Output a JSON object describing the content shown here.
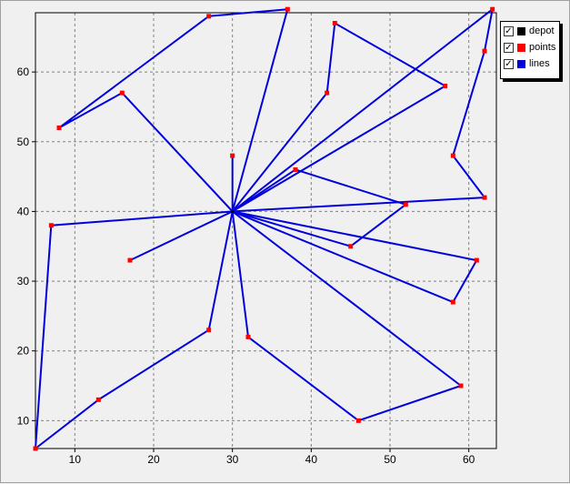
{
  "chart_data": {
    "type": "scatter",
    "xlim": [
      5,
      63.5
    ],
    "ylim": [
      6,
      68.5
    ],
    "x_ticks": [
      10,
      20,
      30,
      40,
      50,
      60
    ],
    "y_ticks": [
      10,
      20,
      30,
      40,
      50,
      60
    ],
    "grid": true,
    "legend_placement": "top-right",
    "depot": {
      "x": 30,
      "y": 40
    },
    "points": [
      {
        "x": 5,
        "y": 6
      },
      {
        "x": 7,
        "y": 38
      },
      {
        "x": 8,
        "y": 52
      },
      {
        "x": 13,
        "y": 13
      },
      {
        "x": 16,
        "y": 57
      },
      {
        "x": 17,
        "y": 33
      },
      {
        "x": 27,
        "y": 68
      },
      {
        "x": 27,
        "y": 23
      },
      {
        "x": 30,
        "y": 48
      },
      {
        "x": 32,
        "y": 22
      },
      {
        "x": 37,
        "y": 69
      },
      {
        "x": 38,
        "y": 46
      },
      {
        "x": 42,
        "y": 57
      },
      {
        "x": 43,
        "y": 67
      },
      {
        "x": 45,
        "y": 35
      },
      {
        "x": 46,
        "y": 10
      },
      {
        "x": 52,
        "y": 41
      },
      {
        "x": 57,
        "y": 58
      },
      {
        "x": 58,
        "y": 48
      },
      {
        "x": 58,
        "y": 27
      },
      {
        "x": 59,
        "y": 15
      },
      {
        "x": 61,
        "y": 33
      },
      {
        "x": 62,
        "y": 63
      },
      {
        "x": 62,
        "y": 42
      },
      {
        "x": 63,
        "y": 69
      }
    ],
    "routes": [
      [
        [
          30,
          40
        ],
        [
          7,
          38
        ],
        [
          5,
          6
        ],
        [
          13,
          13
        ],
        [
          27,
          23
        ],
        [
          30,
          40
        ]
      ],
      [
        [
          30,
          40
        ],
        [
          16,
          57
        ],
        [
          8,
          52
        ],
        [
          27,
          68
        ],
        [
          37,
          69
        ],
        [
          30,
          40
        ]
      ],
      [
        [
          30,
          40
        ],
        [
          42,
          57
        ],
        [
          43,
          67
        ],
        [
          57,
          58
        ],
        [
          30,
          40
        ]
      ],
      [
        [
          30,
          40
        ],
        [
          63,
          69
        ],
        [
          62,
          63
        ],
        [
          58,
          48
        ],
        [
          62,
          42
        ],
        [
          30,
          40
        ]
      ],
      [
        [
          30,
          40
        ],
        [
          38,
          46
        ],
        [
          52,
          41
        ],
        [
          45,
          35
        ],
        [
          30,
          40
        ]
      ],
      [
        [
          30,
          40
        ],
        [
          61,
          33
        ],
        [
          58,
          27
        ],
        [
          30,
          40
        ]
      ],
      [
        [
          30,
          40
        ],
        [
          59,
          15
        ],
        [
          46,
          10
        ],
        [
          32,
          22
        ],
        [
          30,
          40
        ]
      ],
      [
        [
          30,
          40
        ],
        [
          17,
          33
        ]
      ],
      [
        [
          30,
          40
        ],
        [
          30,
          48
        ]
      ]
    ],
    "colors": {
      "depot": "#000000",
      "points": "#ff0000",
      "lines": "#0000dd",
      "grid": "#808080",
      "plot_background": "#f0f0f0"
    }
  },
  "legend": {
    "items": [
      {
        "label": "depot",
        "color": "#000000",
        "checked": "✓"
      },
      {
        "label": "points",
        "color": "#ff0000",
        "checked": "✓"
      },
      {
        "label": "lines",
        "color": "#0000dd",
        "checked": "✓"
      }
    ]
  }
}
